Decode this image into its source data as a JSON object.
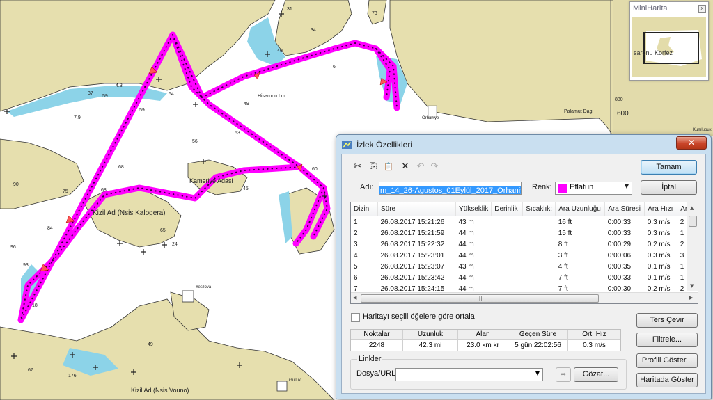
{
  "map": {
    "places": [
      "Hisaronu Lm",
      "Palamut Dagi",
      "Orhaniye",
      "Kameriye Adasi",
      "Kizil Ad (Nsis Kalogera)",
      "Kizil Ad (Nsis Vouno)",
      "Yesilova",
      "Kumlubuk",
      "Gulluk"
    ],
    "depths": [
      "31",
      "34",
      "40",
      "73",
      "54",
      "59",
      "49",
      "37",
      "56",
      "68",
      "59",
      "53",
      "90",
      "75",
      "68",
      "60",
      "45",
      "84",
      "65",
      "96",
      "24",
      "93",
      "18",
      "7.9",
      "176",
      "67",
      "49",
      "6",
      "4.3",
      "880",
      "600"
    ]
  },
  "minimap": {
    "title": "MiniHarita",
    "place_label": "saronu Korfez",
    "close_glyph": "x"
  },
  "dialog": {
    "title": "İzlek Özellikleri",
    "close_glyph": "✕",
    "toolbar": {
      "cut": "✂",
      "copy": "⎘",
      "paste": "📋",
      "delete": "✕",
      "undo": "↶",
      "redo": "↷"
    },
    "name_label": "Adı:",
    "name_value": "m_14_26-Agustos_01Eylül_2017_Orhaniye",
    "color_label": "Renk:",
    "color_value": "Eflatun",
    "color_hex": "#ff00ff",
    "buttons": {
      "ok": "Tamam",
      "cancel": "İptal",
      "reverse": "Ters Çevir",
      "filter": "Filtrele...",
      "profile": "Profili Göster...",
      "show_on_map": "Haritada Göster",
      "browse": "Gözat..."
    },
    "table": {
      "headers": [
        "Dizin",
        "Süre",
        "Yükseklik",
        "Derinlik",
        "Sıcaklık:",
        "Ara Uzunluğu",
        "Ara Süresi",
        "Ara Hızı",
        "Ar"
      ],
      "rows": [
        [
          "1",
          "26.08.2017 15:21:26",
          "43 m",
          "",
          "",
          "16 ft",
          "0:00:33",
          "0.3 m/s",
          "2"
        ],
        [
          "2",
          "26.08.2017 15:21:59",
          "44 m",
          "",
          "",
          "15 ft",
          "0:00:33",
          "0.3 m/s",
          "1"
        ],
        [
          "3",
          "26.08.2017 15:22:32",
          "44 m",
          "",
          "",
          "8 ft",
          "0:00:29",
          "0.2 m/s",
          "2"
        ],
        [
          "4",
          "26.08.2017 15:23:01",
          "44 m",
          "",
          "",
          "3 ft",
          "0:00:06",
          "0.3 m/s",
          "3"
        ],
        [
          "5",
          "26.08.2017 15:23:07",
          "43 m",
          "",
          "",
          "4 ft",
          "0:00:35",
          "0.1 m/s",
          "1"
        ],
        [
          "6",
          "26.08.2017 15:23:42",
          "44 m",
          "",
          "",
          "7 ft",
          "0:00:33",
          "0.1 m/s",
          "1"
        ],
        [
          "7",
          "26.08.2017 15:24:15",
          "44 m",
          "",
          "",
          "7 ft",
          "0:00:30",
          "0.2 m/s",
          "2"
        ]
      ]
    },
    "center_checkbox_label": "Haritayı seçili öğelere göre ortala",
    "stats": {
      "headers": [
        "Noktalar",
        "Uzunluk",
        "Alan",
        "Geçen Süre",
        "Ort. Hız"
      ],
      "values": [
        "2248",
        "42.3 mi",
        "23.0 km kr",
        "5 gün 22:02:56",
        "0.3 m/s"
      ]
    },
    "links": {
      "group_label": "Linkler",
      "file_label": "Dosya/URL:",
      "url_value": ""
    }
  }
}
